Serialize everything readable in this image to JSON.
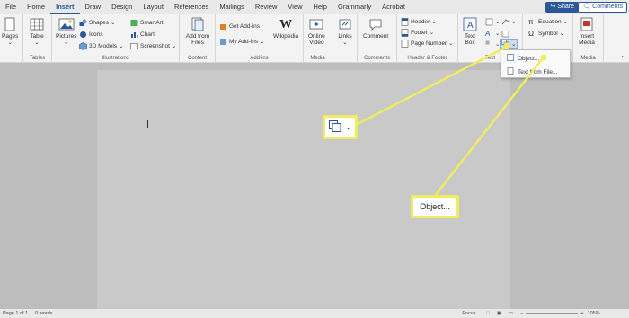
{
  "tabs": [
    "File",
    "Home",
    "Insert",
    "Draw",
    "Design",
    "Layout",
    "References",
    "Mailings",
    "Review",
    "View",
    "Help",
    "Grammarly",
    "Acrobat"
  ],
  "active_tab": "Insert",
  "share_label": "Share",
  "comments_label": "Comments",
  "ribbon": {
    "pages": {
      "label": "Pages"
    },
    "tables": {
      "button": "Table",
      "group": "Tables"
    },
    "illustrations": {
      "pictures": "Pictures",
      "shapes": "Shapes",
      "icons": "Icons",
      "models": "3D Models",
      "smartart": "SmartArt",
      "chart": "Chart",
      "screenshot": "Screenshot",
      "group": "Illustrations"
    },
    "content": {
      "button_line1": "Add from",
      "button_line2": "Files",
      "group": "Content"
    },
    "addins": {
      "get": "Get Add-ins",
      "my": "My Add-ins",
      "wikipedia": "Wikipedia",
      "group": "Add-ins"
    },
    "media": {
      "line1": "Online",
      "line2": "Video",
      "group": "Media"
    },
    "links": {
      "label": "Links"
    },
    "comments": {
      "button": "Comment",
      "group": "Comments"
    },
    "header_footer": {
      "header": "Header",
      "footer": "Footer",
      "page_number": "Page Number",
      "group": "Header & Footer"
    },
    "text": {
      "line1": "Text",
      "line2": "Box",
      "group": "Text"
    },
    "symbols": {
      "equation": "Equation",
      "symbol": "Symbol"
    },
    "insert_media": {
      "line1": "Insert",
      "line2": "Media",
      "group": "Media"
    }
  },
  "dropdown": {
    "items": [
      "Object...",
      "Text from File..."
    ]
  },
  "callout_text": "Object...",
  "status": {
    "page": "Page 1 of 1",
    "words": "0 words",
    "focus": "Focus",
    "zoom": "105%"
  },
  "colors": {
    "accent": "#2b579a",
    "highlight": "#f1ec5f"
  }
}
